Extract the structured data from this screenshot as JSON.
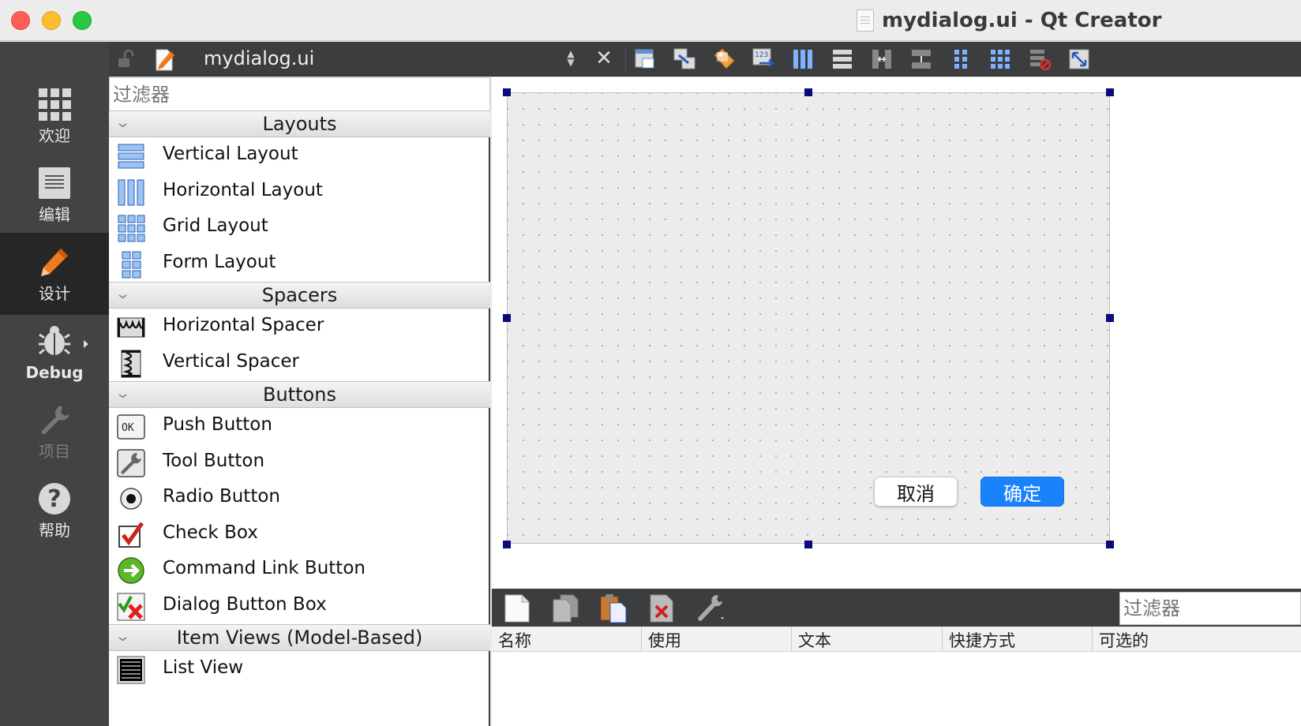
{
  "window": {
    "title": "mydialog.ui - Qt Creator",
    "traffic_lights": [
      "close",
      "minimize",
      "zoom"
    ]
  },
  "modes": [
    {
      "label": "欢迎",
      "icon": "grid-icon"
    },
    {
      "label": "编辑",
      "icon": "document-icon"
    },
    {
      "label": "设计",
      "icon": "pencil-icon",
      "active": true
    },
    {
      "label": "Debug",
      "icon": "bug-icon"
    },
    {
      "label": "项目",
      "icon": "wrench-icon",
      "disabled": true
    },
    {
      "label": "帮助",
      "icon": "help-icon"
    }
  ],
  "toolbar": {
    "file_name": "mydialog.ui",
    "tools": [
      "edit-widgets-icon",
      "edit-signals-slots-icon",
      "edit-buddies-icon",
      "edit-tab-order-icon",
      "lay-out-horizontally-icon",
      "lay-out-vertically-icon",
      "lay-out-horizontal-splitter-icon",
      "lay-out-vertical-splitter-icon",
      "lay-out-form-icon",
      "lay-out-grid-icon",
      "break-layout-icon",
      "adjust-size-icon"
    ]
  },
  "widget_box": {
    "filter_placeholder": "过滤器",
    "categories": [
      {
        "label": "Layouts",
        "items": [
          "Vertical Layout",
          "Horizontal Layout",
          "Grid Layout",
          "Form Layout"
        ]
      },
      {
        "label": "Spacers",
        "items": [
          "Horizontal Spacer",
          "Vertical Spacer"
        ]
      },
      {
        "label": "Buttons",
        "items": [
          "Push Button",
          "Tool Button",
          "Radio Button",
          "Check Box",
          "Command Link Button",
          "Dialog Button Box"
        ]
      },
      {
        "label": "Item Views (Model-Based)",
        "items": [
          "List View"
        ]
      }
    ]
  },
  "form": {
    "cancel_label": "取消",
    "ok_label": "确定"
  },
  "action_editor": {
    "filter_placeholder": "过滤器",
    "columns": [
      "名称",
      "使用",
      "文本",
      "快捷方式",
      "可选的"
    ],
    "tools": [
      "new-action-icon",
      "copy-action-icon",
      "paste-action-icon",
      "delete-action-icon",
      "configure-icon"
    ]
  },
  "colors": {
    "sidebar": "#414345",
    "sidebar_active": "#262626",
    "toolbar": "#3b3d3f",
    "accent": "#1a82fb",
    "selection_handle": "#0a0a7a"
  }
}
